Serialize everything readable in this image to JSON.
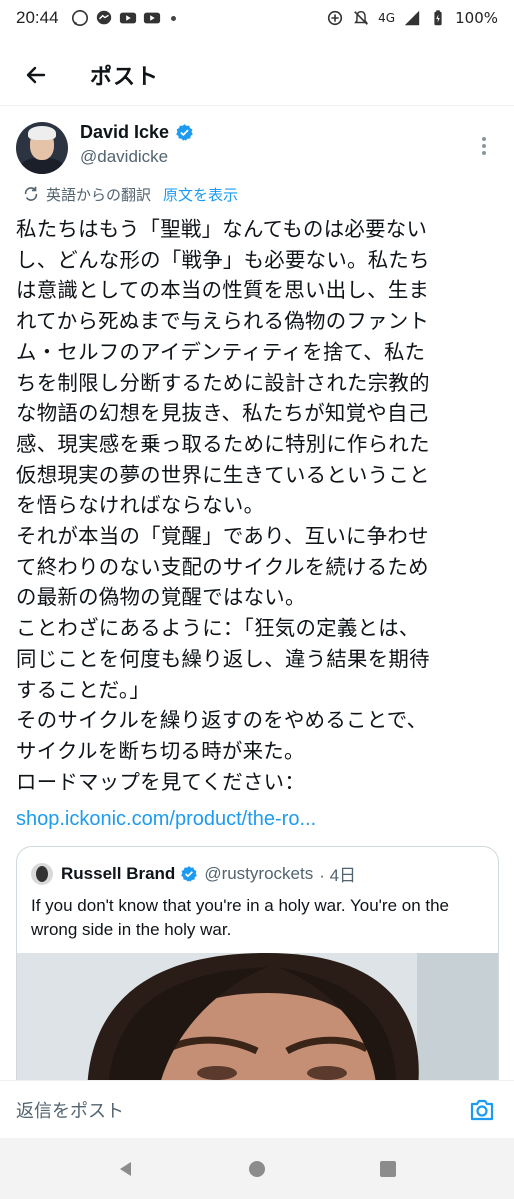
{
  "status_bar": {
    "time": "20:44",
    "network": "4G",
    "battery": "100%"
  },
  "header": {
    "title": "ポスト"
  },
  "author": {
    "name": "David Icke",
    "handle": "@davidicke",
    "verified": true
  },
  "translation": {
    "label": "英語からの翻訳",
    "show_original": "原文を表示"
  },
  "post": {
    "text": "私たちはもう「聖戦」なんてものは必要ない\nし、どんな形の「戦争」も必要ない。私たち\nは意識としての本当の性質を思い出し、生ま\nれてから死ぬまで与えられる偽物のファント\nム・セルフのアイデンティティを捨て、私た\nちを制限し分断するために設計された宗教的\nな物語の幻想を見抜き、私たちが知覚や自己\n感、現実感を乗っ取るために特別に作られた\n仮想現実の夢の世界に生きているということ\nを悟らなければならない。\nそれが本当の「覚醒」であり、互いに争わせ\nて終わりのない支配のサイクルを続けるため\nの最新の偽物の覚醒ではない。\nことわざにあるように：「狂気の定義とは、\n同じことを何度も繰り返し、違う結果を期待\nすることだ。」\nそのサイクルを繰り返すのをやめることで、\nサイクルを断ち切る時が来た。\nロードマップを見てください：",
    "link": "shop.ickonic.com/product/the-ro..."
  },
  "quote": {
    "name": "Russell Brand",
    "handle": "@rustyrockets",
    "time": "· 4日",
    "text": "If you don't know that you're in a holy war. You're on the wrong side in the holy war."
  },
  "reply_bar": {
    "placeholder": "返信をポスト"
  },
  "colors": {
    "accent": "#1d9bf0",
    "secondary_text": "#536471",
    "text": "#0f1419"
  }
}
